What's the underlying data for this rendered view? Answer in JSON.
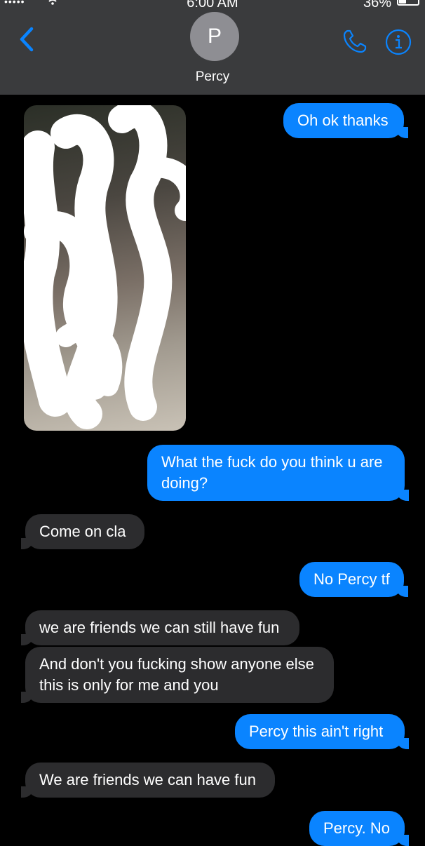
{
  "status_bar": {
    "signal": "•••••",
    "time": "6:00 AM",
    "battery_percent": "36%",
    "battery_level": 0.36
  },
  "header": {
    "avatar_initial": "P",
    "contact_name": "Percy",
    "icons": [
      "chevron-left-icon",
      "phone-icon",
      "info-icon"
    ],
    "accent_color": "#0a84ff"
  },
  "messages": [
    {
      "direction": "sent",
      "text": "Oh ok thanks"
    },
    {
      "direction": "received",
      "type": "photo",
      "note": "redacted image"
    },
    {
      "direction": "sent",
      "text": "What the fuck do you think u are doing?"
    },
    {
      "direction": "received",
      "text": "Come on cla"
    },
    {
      "direction": "sent",
      "text": "No Percy tf"
    },
    {
      "direction": "received",
      "text": "we are friends we can still have fun"
    },
    {
      "direction": "received",
      "text": "And don't you fucking show anyone else this is only for me and you"
    },
    {
      "direction": "sent",
      "text": "Percy this ain't right"
    },
    {
      "direction": "received",
      "text": "We are friends we can have fun"
    },
    {
      "direction": "sent",
      "text": "Percy. No"
    }
  ]
}
